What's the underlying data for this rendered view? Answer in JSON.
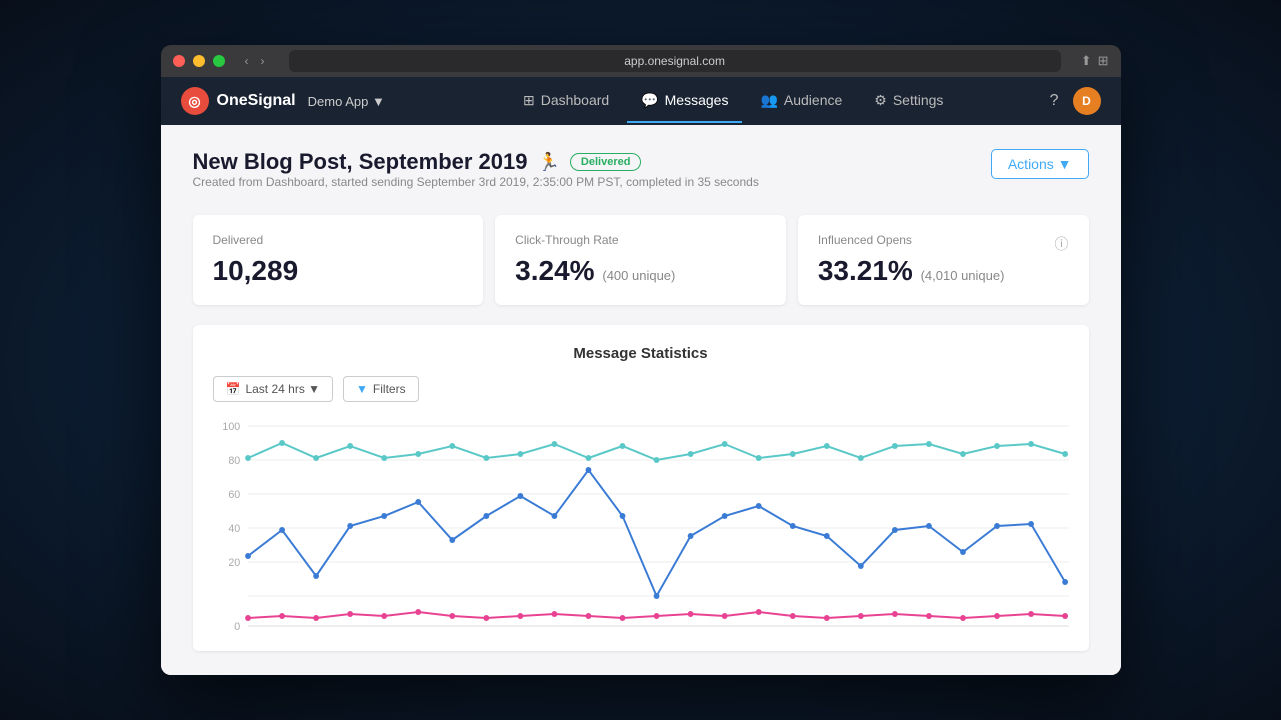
{
  "browser": {
    "address": "app.onesignal.com",
    "dots": [
      "red",
      "yellow",
      "green"
    ]
  },
  "nav": {
    "logo_text": "OneSignal",
    "app_selector": "Demo App ▼",
    "links": [
      {
        "label": "Dashboard",
        "icon": "⊞",
        "active": false
      },
      {
        "label": "Messages",
        "icon": "💬",
        "active": true
      },
      {
        "label": "Audience",
        "icon": "👥",
        "active": false
      },
      {
        "label": "Settings",
        "icon": "⚙",
        "active": false
      }
    ],
    "help_icon": "?",
    "avatar_initials": "D"
  },
  "page": {
    "title": "New Blog Post, September 2019",
    "title_icon": "🏃",
    "status": "Delivered",
    "subtitle": "Created from Dashboard, started sending September 3rd 2019, 2:35:00 PM PST, completed in 35 seconds",
    "actions_label": "Actions ▼"
  },
  "stats": [
    {
      "label": "Delivered",
      "value": "10,289",
      "sub": null
    },
    {
      "label": "Click-Through Rate",
      "value": "3.24%",
      "sub": "(400 unique)"
    },
    {
      "label": "Influenced Opens",
      "value": "33.21%",
      "sub": "(4,010 unique)",
      "help": true
    }
  ],
  "chart": {
    "title": "Message Statistics",
    "filter_label": "Last 24 hrs ▼",
    "filters_label": "Filters",
    "yaxis": [
      "100",
      "80",
      "60",
      "40",
      "20",
      "0"
    ],
    "colors": {
      "teal": "#5bc8c8",
      "blue": "#3a7bd5",
      "pink": "#e84393"
    },
    "teal_data": [
      88,
      92,
      88,
      90,
      88,
      89,
      90,
      88,
      89,
      91,
      88,
      90,
      87,
      89,
      91,
      88,
      89,
      90,
      88,
      90,
      91,
      89,
      90,
      91,
      88
    ],
    "blue_data": [
      35,
      48,
      25,
      50,
      55,
      62,
      43,
      55,
      65,
      55,
      78,
      55,
      15,
      45,
      55,
      60,
      50,
      45,
      30,
      48,
      50,
      37,
      38,
      40,
      22
    ],
    "pink_data": [
      3,
      5,
      4,
      6,
      5,
      7,
      5,
      4,
      5,
      6,
      5,
      4,
      5,
      6,
      5,
      7,
      5,
      4,
      5,
      6,
      5,
      4,
      5,
      6,
      5
    ]
  }
}
